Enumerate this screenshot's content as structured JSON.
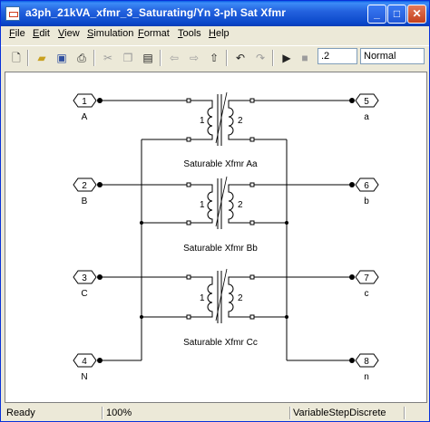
{
  "window": {
    "title": "a3ph_21kVA_xfmr_3_Saturating/Yn 3-ph Sat Xfmr",
    "min": "_",
    "max": "□",
    "close": "✕"
  },
  "menu": [
    "File",
    "Edit",
    "View",
    "Simulation",
    "Format",
    "Tools",
    "Help"
  ],
  "toolbar": {
    "stop_time": ".2",
    "sim_mode": "Normal"
  },
  "model": {
    "inports": [
      {
        "num": "1",
        "label": "A"
      },
      {
        "num": "2",
        "label": "B"
      },
      {
        "num": "3",
        "label": "C"
      },
      {
        "num": "4",
        "label": "N"
      }
    ],
    "outports": [
      {
        "num": "5",
        "label": "a"
      },
      {
        "num": "6",
        "label": "b"
      },
      {
        "num": "7",
        "label": "c"
      },
      {
        "num": "8",
        "label": "n"
      }
    ],
    "transformers": [
      {
        "name": "Saturable Xfmr Aa",
        "winding1": "1",
        "winding2": "2"
      },
      {
        "name": "Saturable Xfmr Bb",
        "winding1": "1",
        "winding2": "2"
      },
      {
        "name": "Saturable Xfmr Cc",
        "winding1": "1",
        "winding2": "2"
      }
    ]
  },
  "status": {
    "state": "Ready",
    "zoom": "100%",
    "solver": "VariableStepDiscrete"
  }
}
